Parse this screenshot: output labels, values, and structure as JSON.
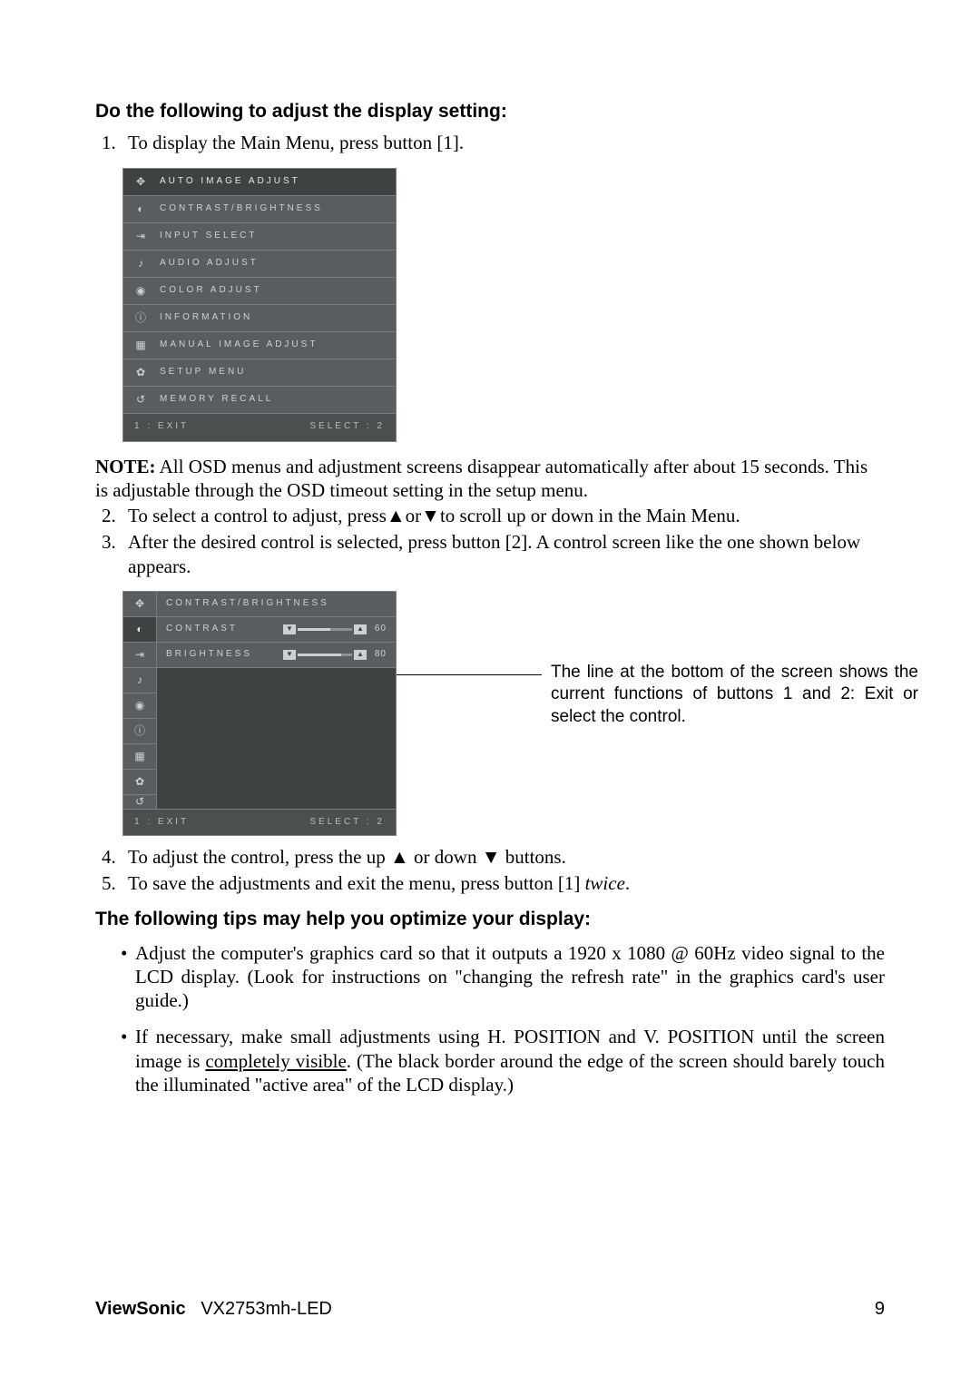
{
  "heading1": "Do the following to adjust the display setting:",
  "step1": "To display the Main Menu, press button [1].",
  "osd1": {
    "items": [
      {
        "icon": "✥",
        "label": "AUTO IMAGE ADJUST",
        "selected": true
      },
      {
        "icon": "◐",
        "label": "CONTRAST/BRIGHTNESS"
      },
      {
        "icon": "⇥",
        "label": "INPUT SELECT"
      },
      {
        "icon": "♪",
        "label": "AUDIO ADJUST"
      },
      {
        "icon": "◉",
        "label": "COLOR ADJUST"
      },
      {
        "icon": "ⓘ",
        "label": "INFORMATION"
      },
      {
        "icon": "▦",
        "label": "MANUAL IMAGE ADJUST"
      },
      {
        "icon": "✿",
        "label": "SETUP MENU"
      },
      {
        "icon": "↺",
        "label": "MEMORY RECALL"
      }
    ],
    "footer_left": "1 : EXIT",
    "footer_right": "SELECT : 2"
  },
  "note_label": "NOTE:",
  "note_text": " All OSD menus and adjustment screens disappear automatically after about 15 seconds. This is adjustable through the OSD timeout setting in the setup menu.",
  "step2_a": "To select a control to adjust, press",
  "step2_b": "or",
  "step2_c": "to scroll up or down in the Main Menu.",
  "step3": "After the desired control is selected, press button [2]. A control screen like the one shown below appears.",
  "osd2": {
    "title": "CONTRAST/BRIGHTNESS",
    "rows": [
      {
        "label": "CONTRAST",
        "value": "60",
        "pct": 60
      },
      {
        "label": "BRIGHTNESS",
        "value": "80",
        "pct": 80
      }
    ],
    "footer_left": "1 : EXIT",
    "footer_right": "SELECT : 2",
    "side_icons": [
      "✥",
      "◐",
      "⇥",
      "♪",
      "◉",
      "ⓘ",
      "▦",
      "✿",
      "↺"
    ]
  },
  "callout": "The line at the bottom of the screen shows the current functions of buttons 1 and 2: Exit or select the control.",
  "step4_a": "To adjust the control, press the up ",
  "step4_b": " or down ",
  "step4_c": " buttons.",
  "step5_a": "To save the adjustments and exit the menu, press button [1] ",
  "step5_b": "twice",
  "step5_c": ".",
  "heading2": "The following tips may help you optimize your display:",
  "tip1": "Adjust the computer's graphics card so that it outputs a 1920 x 1080 @ 60Hz video signal to the LCD display. (Look for instructions on \"changing the refresh rate\" in the graphics card's user guide.)",
  "tip2_a": "If necessary, make small adjustments using H. POSITION and V. POSITION until the screen image is ",
  "tip2_b": "completely visible",
  "tip2_c": ". (The black border around the edge of the screen should barely touch the illuminated \"active area\" of the LCD display.)",
  "footer_brand": "ViewSonic",
  "footer_model": "VX2753mh-LED",
  "page_number": "9"
}
